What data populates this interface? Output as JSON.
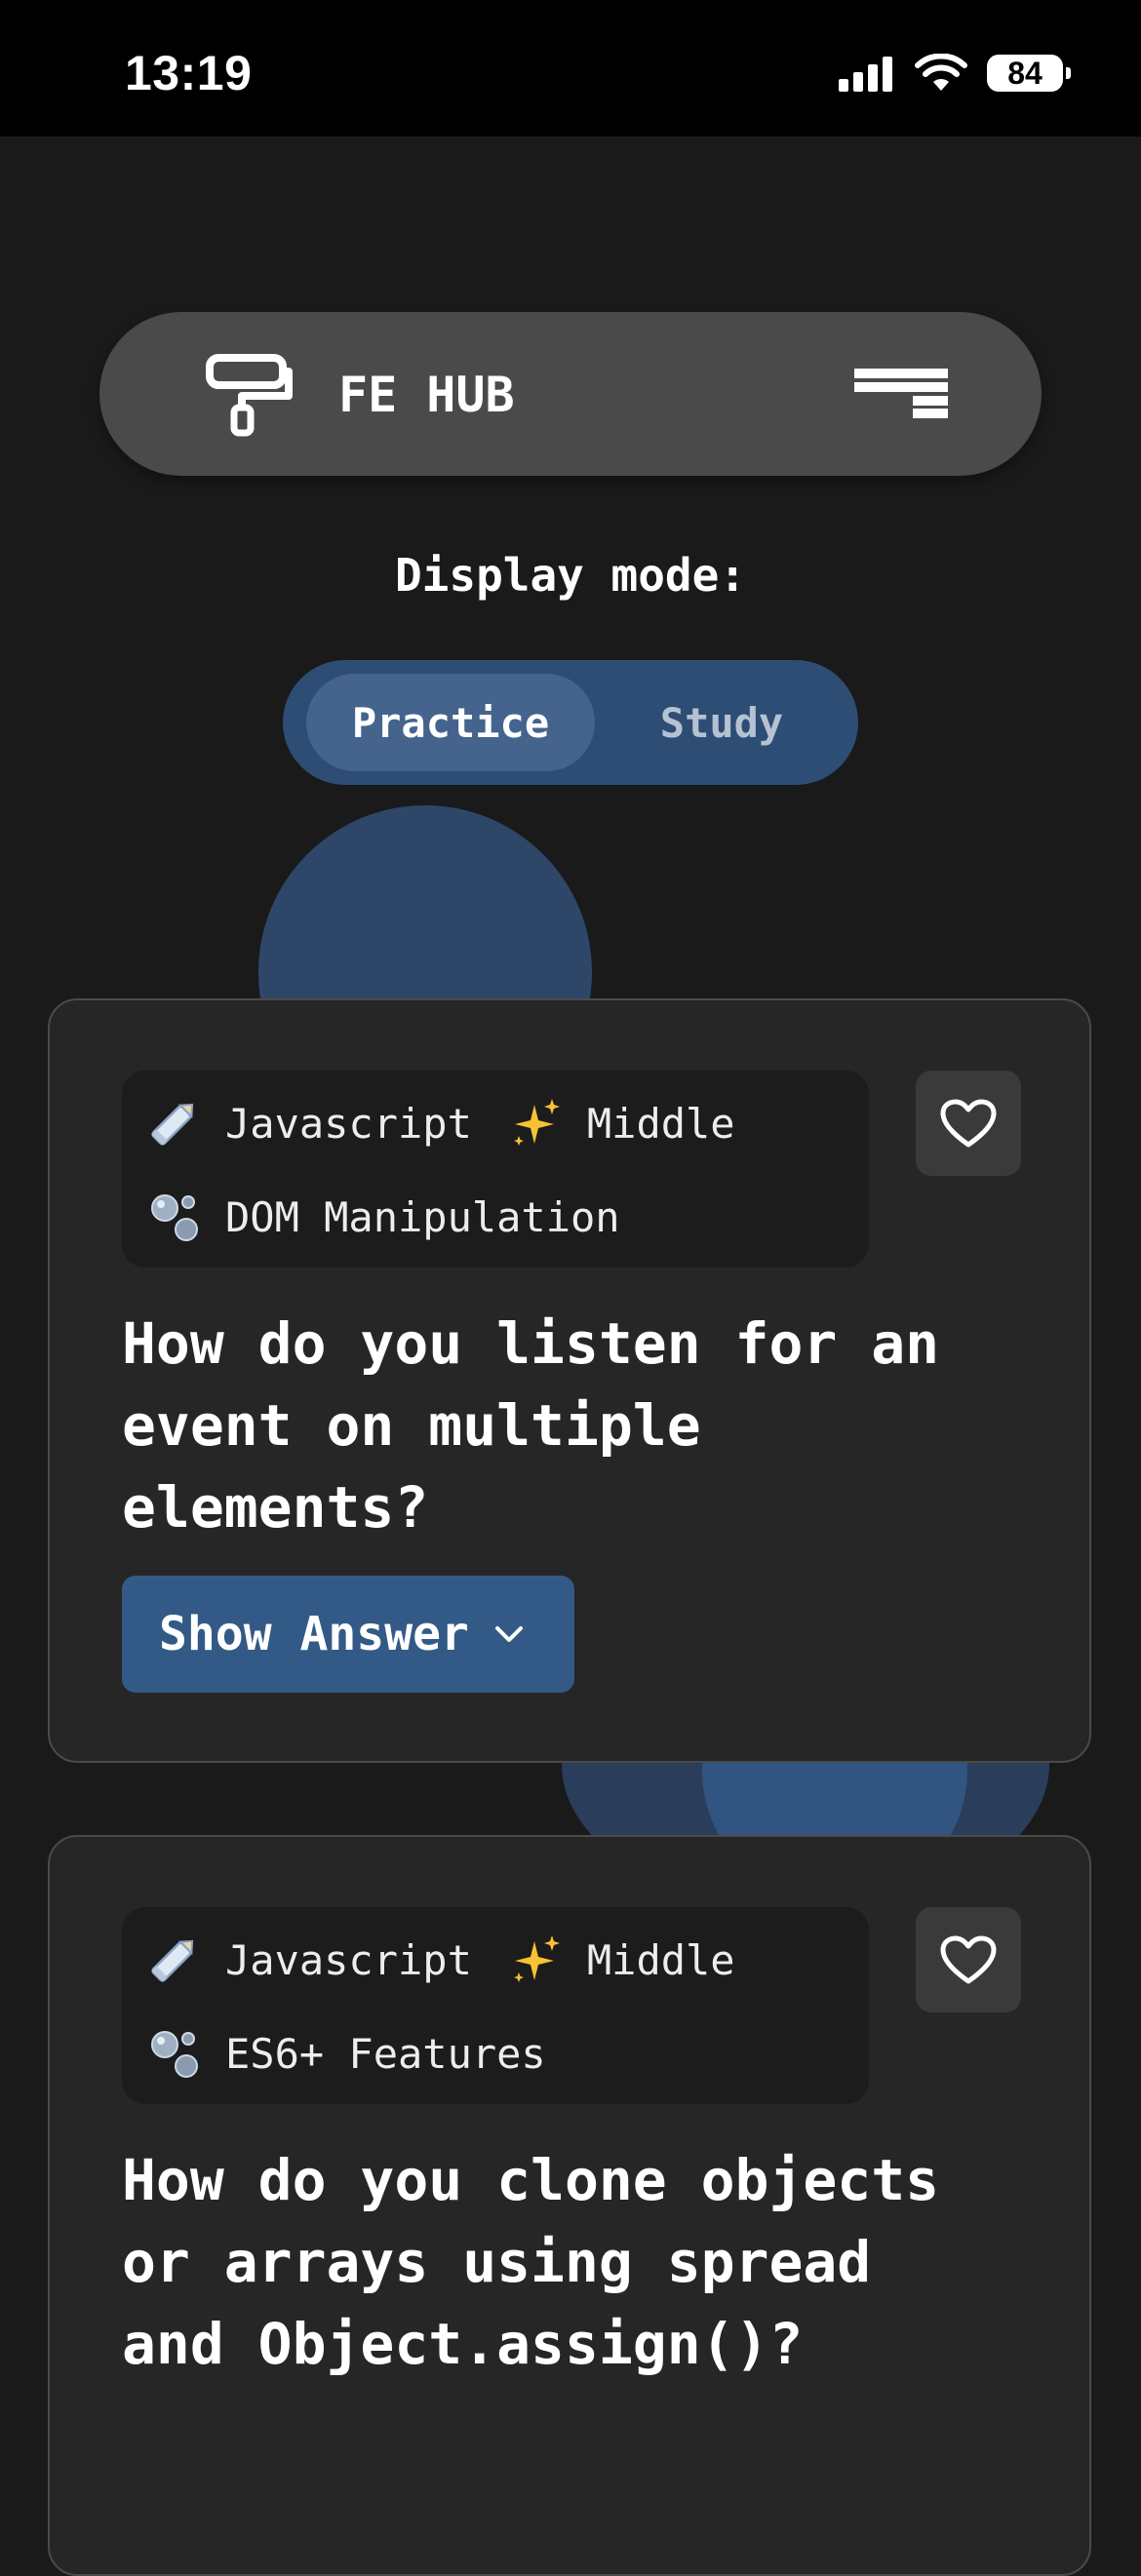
{
  "status_bar": {
    "time": "13:19",
    "battery": "84"
  },
  "navbar": {
    "brand": "FE HUB",
    "logo_icon": "paint-roller-icon",
    "menu_icon": "menu-icon"
  },
  "display_mode": {
    "label": "Display mode:",
    "options": [
      "Practice",
      "Study"
    ],
    "selected": "Practice"
  },
  "cards": [
    {
      "language": "Javascript",
      "level": "Middle",
      "topic": "DOM Manipulation",
      "question": "How do you listen for an event on multiple elements?",
      "show_answer_label": "Show Answer"
    },
    {
      "language": "Javascript",
      "level": "Middle",
      "topic": "ES6+ Features",
      "question": "How do you clone objects or arrays using spread and Object.assign()?"
    }
  ],
  "colors": {
    "background": "#1a1a1b",
    "navbar": "#4a4a4b",
    "toggle": "#2e4d74",
    "accent_button": "#335a87",
    "card": "#262626"
  }
}
